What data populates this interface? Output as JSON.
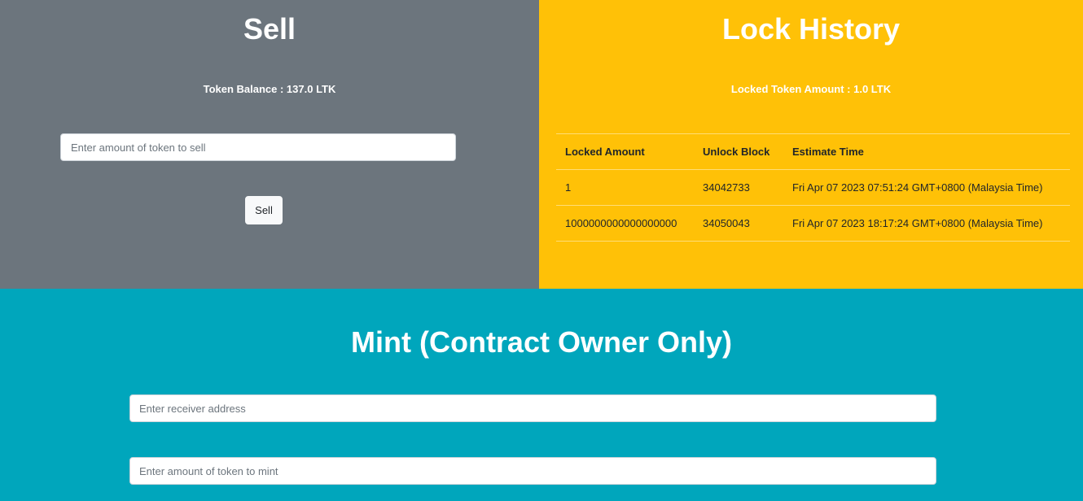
{
  "sell": {
    "title": "Sell",
    "balance_text": "Token Balance : 137.0 LTK",
    "input_placeholder": "Enter amount of token to sell",
    "button_label": "Sell"
  },
  "lock_history": {
    "title": "Lock History",
    "locked_amount_text": "Locked Token Amount : 1.0 LTK",
    "columns": [
      "Locked Amount",
      "Unlock Block",
      "Estimate Time"
    ],
    "rows": [
      [
        "1",
        "34042733",
        "Fri Apr 07 2023 07:51:24 GMT+0800 (Malaysia Time)"
      ],
      [
        "1000000000000000000",
        "34050043",
        "Fri Apr 07 2023 18:17:24 GMT+0800 (Malaysia Time)"
      ]
    ]
  },
  "mint": {
    "title": "Mint (Contract Owner Only)",
    "receiver_placeholder": "Enter receiver address",
    "amount_placeholder": "Enter amount of token to mint"
  },
  "colors": {
    "sell_bg": "#6c757d",
    "lock_bg": "#ffc107",
    "mint_bg": "#00a6bc"
  }
}
